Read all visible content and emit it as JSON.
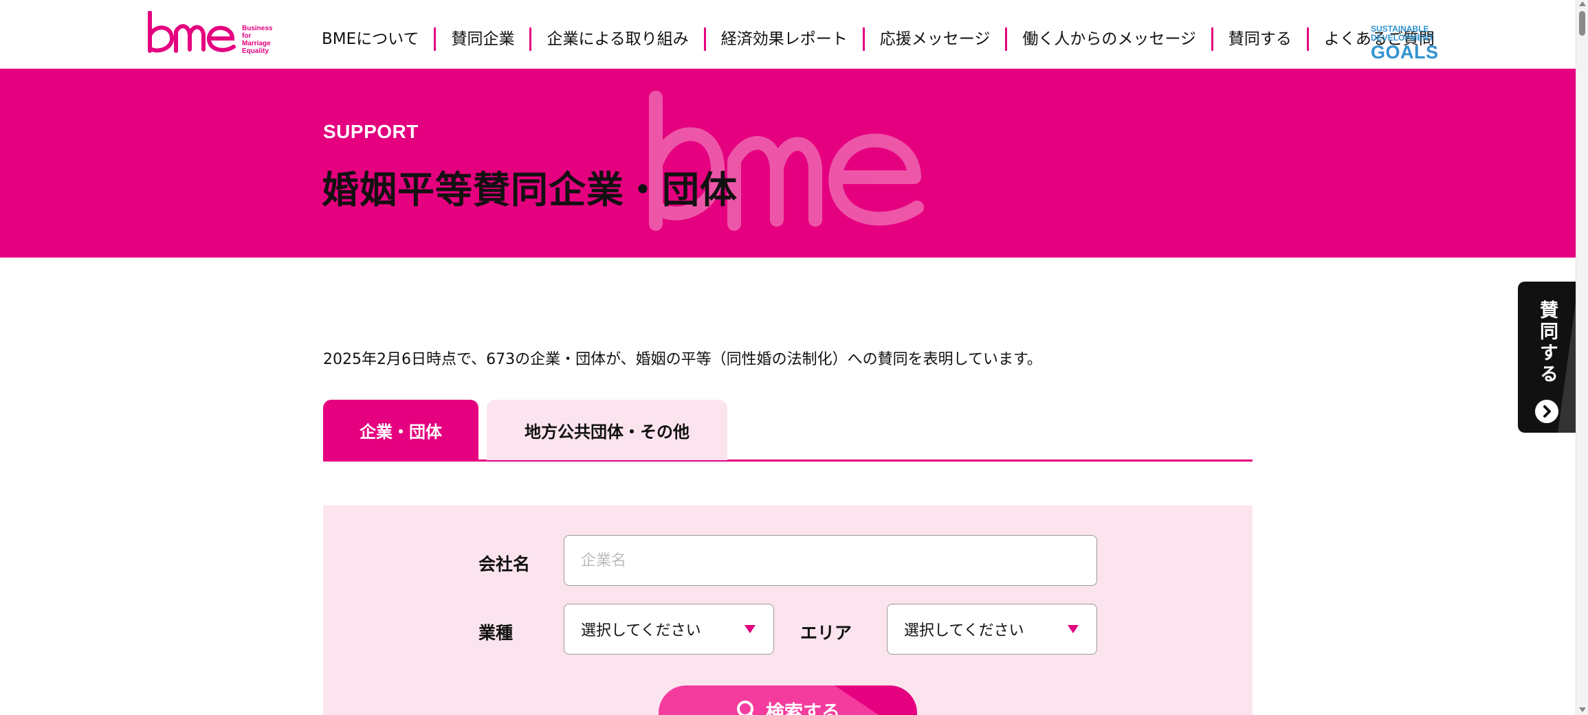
{
  "header": {
    "logo_text": "bme",
    "logo_sub": [
      "Business",
      "for",
      "Marriage",
      "Equality"
    ],
    "nav": [
      {
        "label": "BMEについて"
      },
      {
        "label": "賛同企業"
      },
      {
        "label": "企業による取り組み"
      },
      {
        "label": "経済効果レポート"
      },
      {
        "label": "応援メッセージ"
      },
      {
        "label": "働く人からのメッセージ"
      },
      {
        "label": "賛同する"
      },
      {
        "label": "よくあるご質問"
      }
    ],
    "sdg_line1": "SUSTAINABLE",
    "sdg_line2": "DEVELOPMENT",
    "sdg_line3": "GOALS"
  },
  "hero": {
    "eyebrow": "SUPPORT",
    "title": "婚姻平等賛同企業・団体"
  },
  "intro_text": "2025年2月6日時点で、673の企業・団体が、婚姻の平等（同性婚の法制化）への賛同を表明しています。",
  "tabs": [
    {
      "label": "企業・団体",
      "active": true
    },
    {
      "label": "地方公共団体・その他",
      "active": false
    }
  ],
  "search": {
    "company_label": "会社名",
    "company_placeholder": "企業名",
    "industry_label": "業種",
    "industry_value": "選択してください",
    "area_label": "エリア",
    "area_value": "選択してください",
    "button_label": "検索する"
  },
  "side_cta": {
    "label": "賛同する"
  },
  "colors": {
    "brand_pink": "#e4007f",
    "light_pink": "#fce4ef",
    "button_pink": "#f33c9d",
    "sdg_blue": "#2f93d0"
  }
}
